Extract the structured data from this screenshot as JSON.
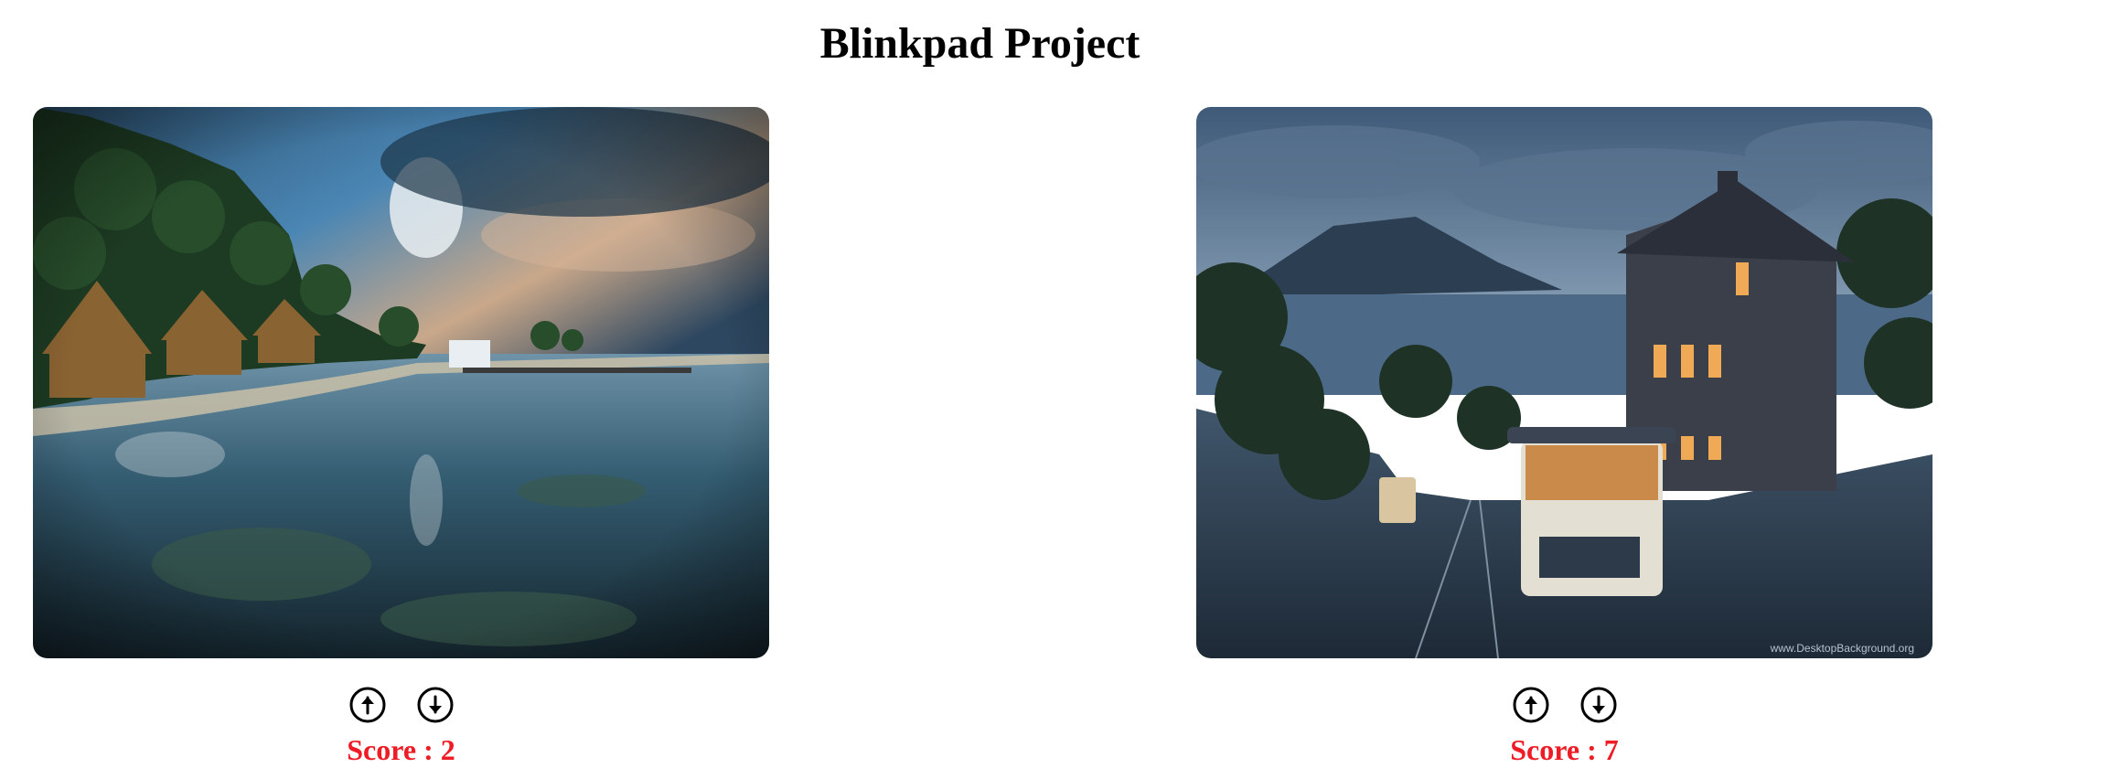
{
  "page": {
    "title": "Blinkpad Project"
  },
  "cards": [
    {
      "image_subject": "tropical beach huts and palm trees at a lagoon with pier",
      "score_label": "Score : ",
      "score_value": "2",
      "icons": {
        "upvote": "arrow-up-circle-icon",
        "downvote": "arrow-down-circle-icon"
      }
    },
    {
      "image_subject": "evening city street with cable car, victorian house and bay view",
      "score_label": "Score : ",
      "score_value": "7",
      "icons": {
        "upvote": "arrow-up-circle-icon",
        "downvote": "arrow-down-circle-icon"
      },
      "watermark": "www.DesktopBackground.org"
    }
  ],
  "colors": {
    "score": "#ee1c25",
    "title": "#000000"
  }
}
